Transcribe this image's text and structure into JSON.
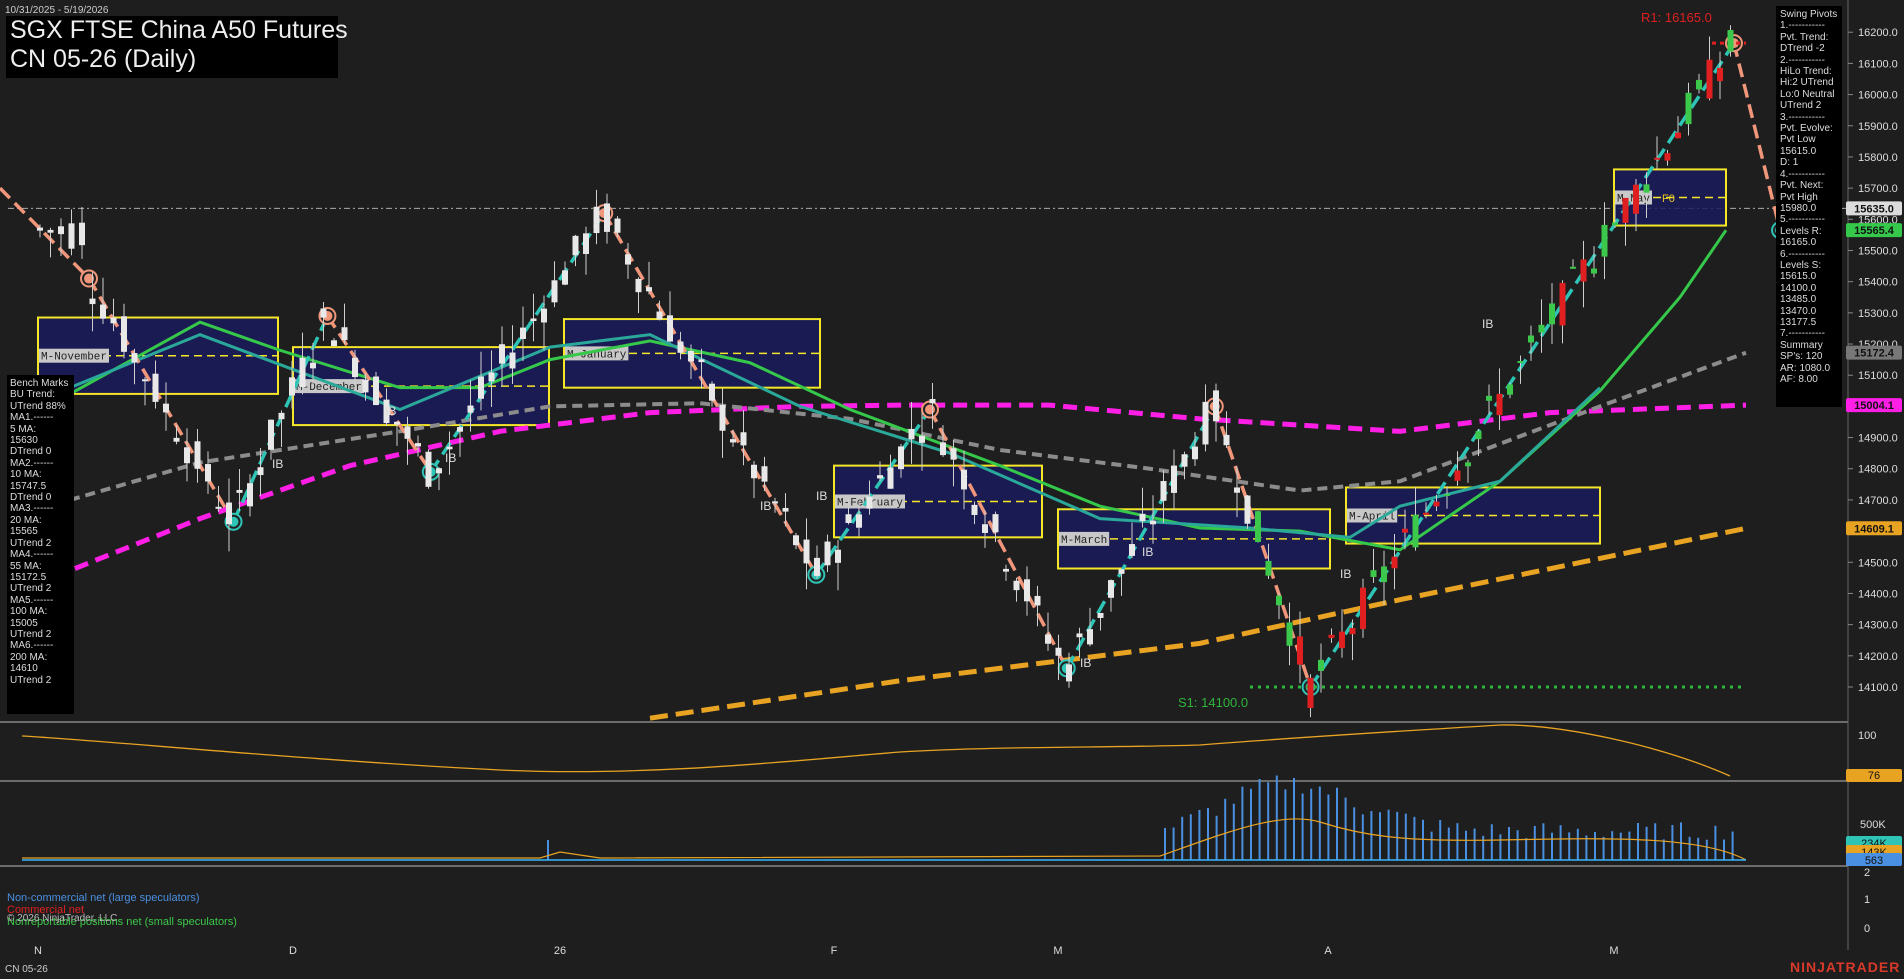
{
  "header": {
    "date_range": "10/31/2025 - 5/19/2026",
    "title_line1": "SGX FTSE China A50 Futures",
    "title_line2": "CN 05-26 (Daily)"
  },
  "footer": {
    "instrument": "CN 05-26",
    "brand": "NINJATRADER",
    "copyright": "© 2026 NinjaTrader, LLC"
  },
  "annotations": {
    "r1": "R1: 16165.0",
    "s1": "S1: 14100.0",
    "ib": "IB",
    "f0": "F0"
  },
  "swing_panel": [
    "Swing Pivots",
    "1.-----------",
    "Pvt. Trend:",
    "DTrend -2",
    "2.-----------",
    "HiLo Trend:",
    "Hi:2 UTrend",
    "Lo:0 Neutral",
    "UTrend 2",
    "3.-----------",
    "Pvt. Evolve:",
    "Pvt Low",
    "15615.0",
    "D: 1",
    "4.-----------",
    "Pvt. Next:",
    "Pvt High",
    "15980.0",
    "5.-----------",
    "Levels R:",
    "16165.0",
    "6.-----------",
    "Levels S:",
    "15615.0",
    "14100.0",
    "13485.0",
    "13470.0",
    "13177.5",
    "7.-----------",
    "Summary",
    "SP's: 120",
    "AR: 1080.0",
    "AF: 8.00"
  ],
  "bench_panel": [
    "Bench Marks",
    "BU Trend:",
    "UTrend 88%",
    "MA1.------",
    "5 MA:",
    "15630",
    "DTrend 0",
    "MA2.------",
    "10 MA:",
    "15747.5",
    "DTrend 0",
    "MA3.------",
    "20 MA:",
    "15565",
    "UTrend 2",
    "MA4.------",
    "55 MA:",
    "15172.5",
    "UTrend 2",
    "MA5.------",
    "100 MA:",
    "15005",
    "UTrend 2",
    "MA6.------",
    "200 MA:",
    "14610",
    "UTrend 2"
  ],
  "legend": [
    {
      "label": "Non-commercial net (large speculators)",
      "color": "#4a90e2"
    },
    {
      "label": "Commercial net",
      "color": "#e02020"
    },
    {
      "label": "Nonreportable positions net (small speculators)",
      "color": "#3cc84a"
    }
  ],
  "colors": {
    "background": "#1e1e1e",
    "pivot_up_line": "#2ec4b6",
    "pivot_down_line": "#f0967a",
    "ma_magenta": "#ff1ee6",
    "ma_orange": "#e8a323",
    "ma_gray": "#8c8c8c",
    "ma_green": "#35c84a",
    "ma_teal": "#2aa89a",
    "box_fill": "#1b1b5e",
    "box_border": "#f5e628"
  },
  "chart_data": [
    {
      "type": "candlestick",
      "title": "SGX FTSE China A50 Futures CN 05-26 (Daily)",
      "x_ticks": [
        "N",
        "D",
        "26",
        "F",
        "M",
        "A",
        "M"
      ],
      "ylim": [
        14000,
        16250
      ],
      "y_ticks": [
        14100,
        14200,
        14300,
        14400,
        14500,
        14600,
        14700,
        14800,
        14900,
        15000,
        15100,
        15200,
        15300,
        15400,
        15500,
        15600,
        15700,
        15800,
        15900,
        16000,
        16100,
        16200
      ],
      "price_tags": [
        {
          "label": "15635.0",
          "value": 15635,
          "bg": "#dcdcdc",
          "fg": "#111"
        },
        {
          "label": "15565.4",
          "value": 15565.4,
          "bg": "#35c84a",
          "fg": "#111"
        },
        {
          "label": "15172.4",
          "value": 15172.4,
          "bg": "#777777",
          "fg": "#111"
        },
        {
          "label": "15004.1",
          "value": 15004.1,
          "bg": "#ff1ee6",
          "fg": "#111"
        },
        {
          "label": "14609.1",
          "value": 14609.1,
          "bg": "#e8a323",
          "fg": "#111"
        }
      ],
      "swing_pivots": [
        {
          "x": "Nov-07",
          "value": 15410,
          "kind": "high"
        },
        {
          "x": "Nov-24",
          "value": 14630,
          "kind": "low"
        },
        {
          "x": "Dec-05",
          "value": 15290,
          "kind": "high"
        },
        {
          "x": "Dec-17",
          "value": 14790,
          "kind": "low"
        },
        {
          "x": "Jan-06",
          "value": 15620,
          "kind": "high"
        },
        {
          "x": "Jan-30",
          "value": 14460,
          "kind": "low"
        },
        {
          "x": "Feb-13",
          "value": 14990,
          "kind": "high"
        },
        {
          "x": "Mar-02",
          "value": 14160,
          "kind": "low"
        },
        {
          "x": "Mar-19",
          "value": 15000,
          "kind": "high"
        },
        {
          "x": "Mar-30",
          "value": 14100,
          "kind": "low"
        },
        {
          "x": "May-14",
          "value": 16165,
          "kind": "high"
        },
        {
          "x": "May-19",
          "value": 15565,
          "kind": "low"
        }
      ],
      "monthly_boxes": [
        {
          "label": "M-November",
          "high": 15285,
          "low": 15040
        },
        {
          "label": "M-December",
          "high": 15190,
          "low": 14940
        },
        {
          "label": "M-January",
          "high": 15280,
          "low": 15060
        },
        {
          "label": "M-February",
          "high": 14810,
          "low": 14580
        },
        {
          "label": "M-March",
          "high": 14670,
          "low": 14480
        },
        {
          "label": "M-April",
          "high": 14740,
          "low": 14560
        },
        {
          "label": "M-May",
          "high": 15760,
          "low": 15580
        }
      ]
    },
    {
      "type": "line",
      "name": "oscillator",
      "y_ticks": [
        100
      ],
      "last_value_label": "76"
    },
    {
      "type": "bar",
      "name": "volume",
      "y_ticks": [
        "500K"
      ],
      "tags": [
        "234K",
        "143K",
        "563"
      ]
    },
    {
      "type": "line",
      "name": "cot",
      "y_ticks": [
        2,
        1,
        0
      ]
    }
  ]
}
